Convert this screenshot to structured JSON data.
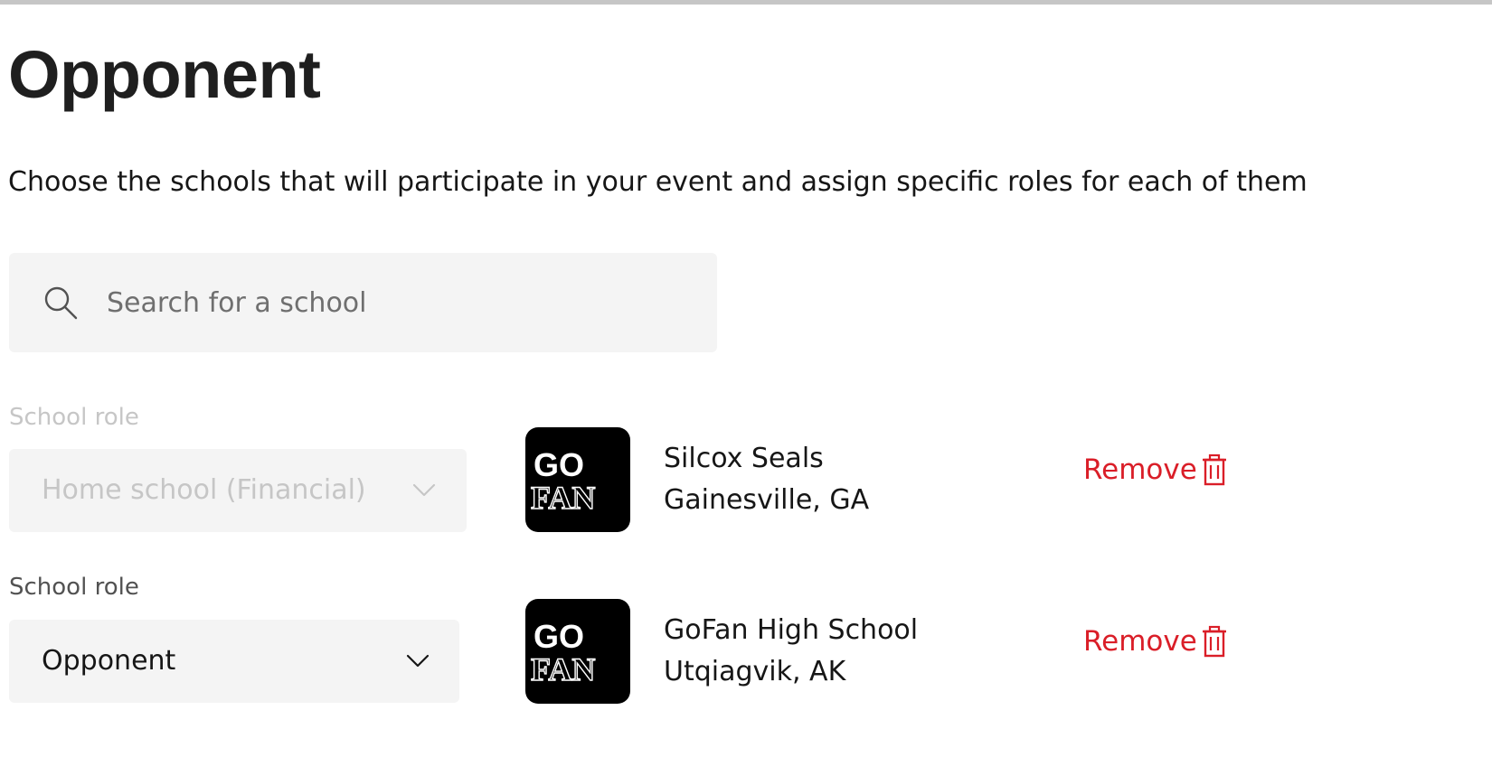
{
  "page": {
    "title": "Opponent",
    "description": "Choose the schools that will participate in your event and assign specific roles for each of them"
  },
  "search": {
    "placeholder": "Search for a school",
    "value": ""
  },
  "schools": [
    {
      "role_label": "School role",
      "role_value": "Home school (Financial)",
      "role_disabled": true,
      "logo_text": [
        "GO",
        "FAN"
      ],
      "name": "Silcox Seals",
      "location": "Gainesville, GA",
      "remove_label": "Remove"
    },
    {
      "role_label": "School role",
      "role_value": "Opponent",
      "role_disabled": false,
      "logo_text": [
        "GO",
        "FAN"
      ],
      "name": "GoFan High School",
      "location": "Utqiagvik, AK",
      "remove_label": "Remove"
    }
  ],
  "icons": {
    "search": "search-icon",
    "chevron": "chevron-down-icon",
    "trash": "trash-icon",
    "logo": "gofan-logo"
  },
  "colors": {
    "danger": "#da1e28",
    "field_bg": "#f4f4f4",
    "disabled_text": "#c6c6c6",
    "logo_bg": "#000000"
  }
}
